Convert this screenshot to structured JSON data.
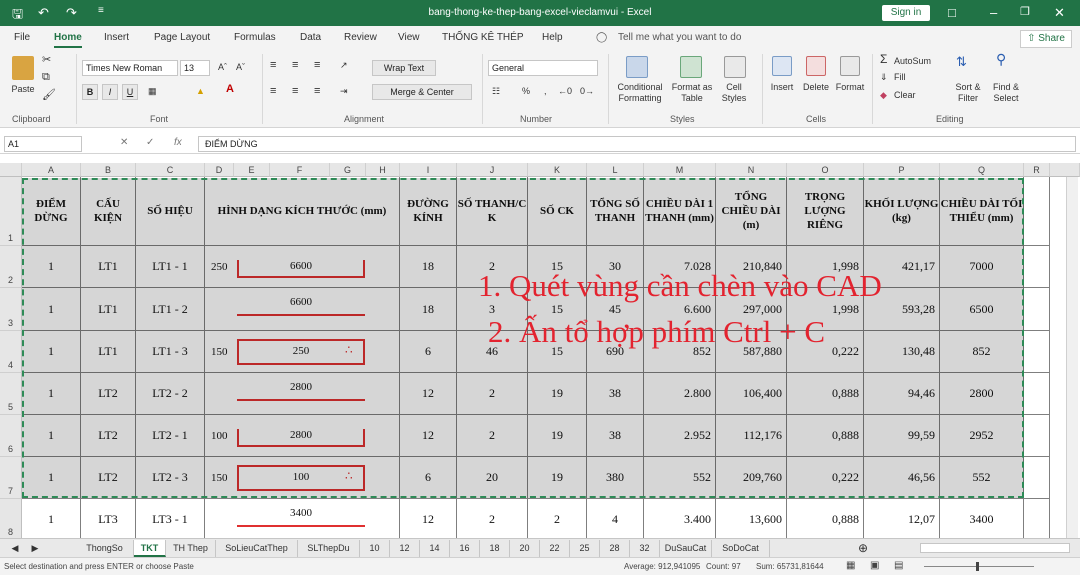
{
  "title": "bang-thong-ke-thep-bang-excel-vieclamvui - Excel",
  "signin": "Sign in",
  "menu": [
    "File",
    "Home",
    "Insert",
    "Page Layout",
    "Formulas",
    "Data",
    "Review",
    "View",
    "THỐNG KÊ THÉP",
    "Help"
  ],
  "tell_me": "Tell me what you want to do",
  "share": "Share",
  "ribbon": {
    "clipboard": {
      "paste": "Paste",
      "label": "Clipboard"
    },
    "font": {
      "name": "Times New Roman",
      "size": "13",
      "bold": "B",
      "italic": "I",
      "underline": "U",
      "label": "Font"
    },
    "alignment": {
      "wrap": "Wrap Text",
      "merge": "Merge & Center",
      "label": "Alignment"
    },
    "number": {
      "format": "General",
      "label": "Number"
    },
    "styles": {
      "cond": "Conditional Formatting",
      "fmt_table": "Format as Table",
      "cell_styles": "Cell Styles",
      "label": "Styles"
    },
    "cells": {
      "insert": "Insert",
      "delete": "Delete",
      "format": "Format",
      "label": "Cells"
    },
    "editing": {
      "autosum": "AutoSum",
      "fill": "Fill",
      "clear": "Clear",
      "sort": "Sort & Filter",
      "find": "Find & Select",
      "label": "Editing"
    }
  },
  "namebox": "A1",
  "formula": "ĐIỂM DỪNG",
  "columns": [
    "A",
    "B",
    "C",
    "D",
    "E",
    "F",
    "G",
    "H",
    "I",
    "J",
    "K",
    "L",
    "M",
    "N",
    "O",
    "P",
    "Q",
    "R"
  ],
  "row_numbers": [
    "1",
    "2",
    "3",
    "4",
    "5",
    "6",
    "7",
    "8"
  ],
  "headers": {
    "diem_dung": "ĐIỂM DỪNG",
    "cau_kien": "CẤU KIỆN",
    "so_hieu": "SỐ HIỆU",
    "hinh_dang": "HÌNH DẠNG KÍCH THƯỚC (mm)",
    "duong_kinh": "ĐƯỜNG KÍNH",
    "so_thanh_ck": "SỐ THANH/C K",
    "so_ck": "SỐ CK",
    "tong_so_thanh": "TỔNG SỐ THANH",
    "chieu_dai_1": "CHIỀU DÀI 1 THANH (mm)",
    "tong_chieu_dai": "TỔNG CHIỀU DÀI (m)",
    "trong_luong": "TRỌNG LƯỢNG RIÊNG",
    "khoi_luong": "KHỐI LƯỢNG (kg)",
    "chieu_dai_min": "CHIỀU DÀI TỐI THIỂU (mm)"
  },
  "rows": [
    {
      "diem": "1",
      "cau": "LT1",
      "hieu": "LT1 - 1",
      "left": "250",
      "dim": "6600",
      "dk": "18",
      "st": "2",
      "ck": "15",
      "ts": "30",
      "cd1": "7.028",
      "tcd": "210,840",
      "tl": "1,998",
      "kl": "421,17",
      "min": "7000"
    },
    {
      "diem": "1",
      "cau": "LT1",
      "hieu": "LT1 - 2",
      "left": "",
      "dim": "6600",
      "dk": "18",
      "st": "3",
      "ck": "15",
      "ts": "45",
      "cd1": "6.600",
      "tcd": "297,000",
      "tl": "1,998",
      "kl": "593,28",
      "min": "6500"
    },
    {
      "diem": "1",
      "cau": "LT1",
      "hieu": "LT1 - 3",
      "left": "150",
      "dim": "250",
      "dk": "6",
      "st": "46",
      "ck": "15",
      "ts": "690",
      "cd1": "852",
      "tcd": "587,880",
      "tl": "0,222",
      "kl": "130,48",
      "min": "852"
    },
    {
      "diem": "1",
      "cau": "LT2",
      "hieu": "LT2 - 2",
      "left": "",
      "dim": "2800",
      "dk": "12",
      "st": "2",
      "ck": "19",
      "ts": "38",
      "cd1": "2.800",
      "tcd": "106,400",
      "tl": "0,888",
      "kl": "94,46",
      "min": "2800"
    },
    {
      "diem": "1",
      "cau": "LT2",
      "hieu": "LT2 - 1",
      "left": "100",
      "dim": "2800",
      "dk": "12",
      "st": "2",
      "ck": "19",
      "ts": "38",
      "cd1": "2.952",
      "tcd": "112,176",
      "tl": "0,888",
      "kl": "99,59",
      "min": "2952"
    },
    {
      "diem": "1",
      "cau": "LT2",
      "hieu": "LT2 - 3",
      "left": "150",
      "dim": "100",
      "dk": "6",
      "st": "20",
      "ck": "19",
      "ts": "380",
      "cd1": "552",
      "tcd": "209,760",
      "tl": "0,222",
      "kl": "46,56",
      "min": "552"
    },
    {
      "diem": "1",
      "cau": "LT3",
      "hieu": "LT3 - 1",
      "left": "",
      "dim": "3400",
      "dk": "12",
      "st": "2",
      "ck": "2",
      "ts": "4",
      "cd1": "3.400",
      "tcd": "13,600",
      "tl": "0,888",
      "kl": "12,07",
      "min": "3400"
    }
  ],
  "annotation": [
    "1. Quét vùng cần chèn vào CAD",
    "2. Ấn tổ hợp phím Ctrl + C"
  ],
  "sheet_tabs": [
    "ThongSo",
    "TKT",
    "TH Thep",
    "SoLieuCatThep",
    "SLThepDu",
    "10",
    "12",
    "14",
    "16",
    "18",
    "20",
    "22",
    "25",
    "28",
    "32",
    "DuSauCat",
    "SoDoCat"
  ],
  "status": {
    "left": "Select destination and press ENTER or choose Paste",
    "average": "Average: 912,941095",
    "count": "Count: 97",
    "sum": "Sum: 65731,81644"
  }
}
